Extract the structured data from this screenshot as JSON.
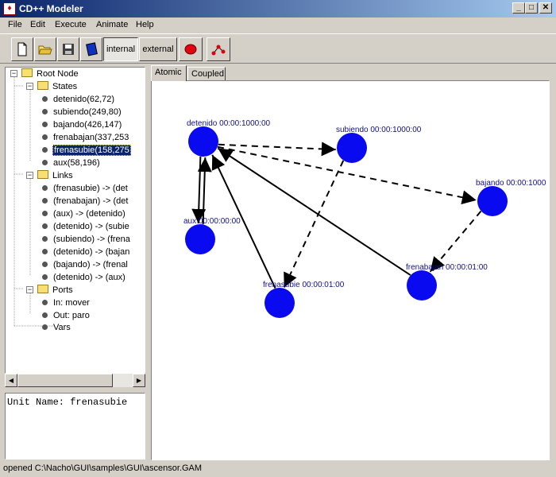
{
  "window": {
    "title": "CD++ Modeler",
    "minimize": "_",
    "maximize": "□",
    "close": "✕"
  },
  "menu": [
    "File",
    "Edit",
    "Execute",
    "Animate",
    "Help"
  ],
  "toolbar": {
    "internal_label": "internal",
    "external_label": "external"
  },
  "tree": {
    "root": "Root Node",
    "states_label": "States",
    "states": [
      "detenido(62,72)",
      "subiendo(249,80)",
      "bajando(426,147)",
      "frenabajan(337,253",
      "frenasubie(158,275",
      "aux(58,196)"
    ],
    "selected_state": 4,
    "links_label": "Links",
    "links": [
      "(frenasubie) -> (det",
      "(frenabajan) -> (det",
      "(aux) -> (detenido)",
      "(detenido) -> (subie",
      "(subiendo) -> (frena",
      "(detenido) -> (bajan",
      "(bajando) -> (frenal",
      "(detenido) -> (aux)"
    ],
    "ports_label": "Ports",
    "ports": [
      "In: mover",
      "Out: paro"
    ],
    "vars_label": "Vars"
  },
  "unit_name": "Unit Name: frenasubie",
  "tabs": {
    "atomic": "Atomic",
    "coupled": "Coupled",
    "active": "atomic"
  },
  "diagram": {
    "node_color": "#0a0af0",
    "label_color": "#10108a",
    "nodes": [
      {
        "id": "detenido",
        "label": "detenido 00:00:1000:00"
      },
      {
        "id": "subiendo",
        "label": "subiendo 00:00:1000:00"
      },
      {
        "id": "bajando",
        "label": "bajando 00:00:1000"
      },
      {
        "id": "frenabajan",
        "label": "frenabajan 00:00:01:00"
      },
      {
        "id": "frenasubie",
        "label": "frenasubie 00:00:01:00"
      },
      {
        "id": "aux",
        "label": "aux 00:00:00:00"
      }
    ],
    "edges": [
      {
        "from": "detenido",
        "to": "subiendo",
        "style": "dashed"
      },
      {
        "from": "detenido",
        "to": "bajando",
        "style": "dashed"
      },
      {
        "from": "subiendo",
        "to": "frenasubie",
        "style": "dashed"
      },
      {
        "from": "bajando",
        "to": "frenabajan",
        "style": "dashed"
      },
      {
        "from": "frenasubie",
        "to": "detenido",
        "style": "solid"
      },
      {
        "from": "frenabajan",
        "to": "detenido",
        "style": "solid"
      },
      {
        "from": "detenido",
        "to": "aux",
        "style": "solid"
      },
      {
        "from": "aux",
        "to": "detenido",
        "style": "solid"
      }
    ]
  },
  "status": "opened C:\\Nacho\\GUI\\samples\\GUI\\ascensor.GAM"
}
